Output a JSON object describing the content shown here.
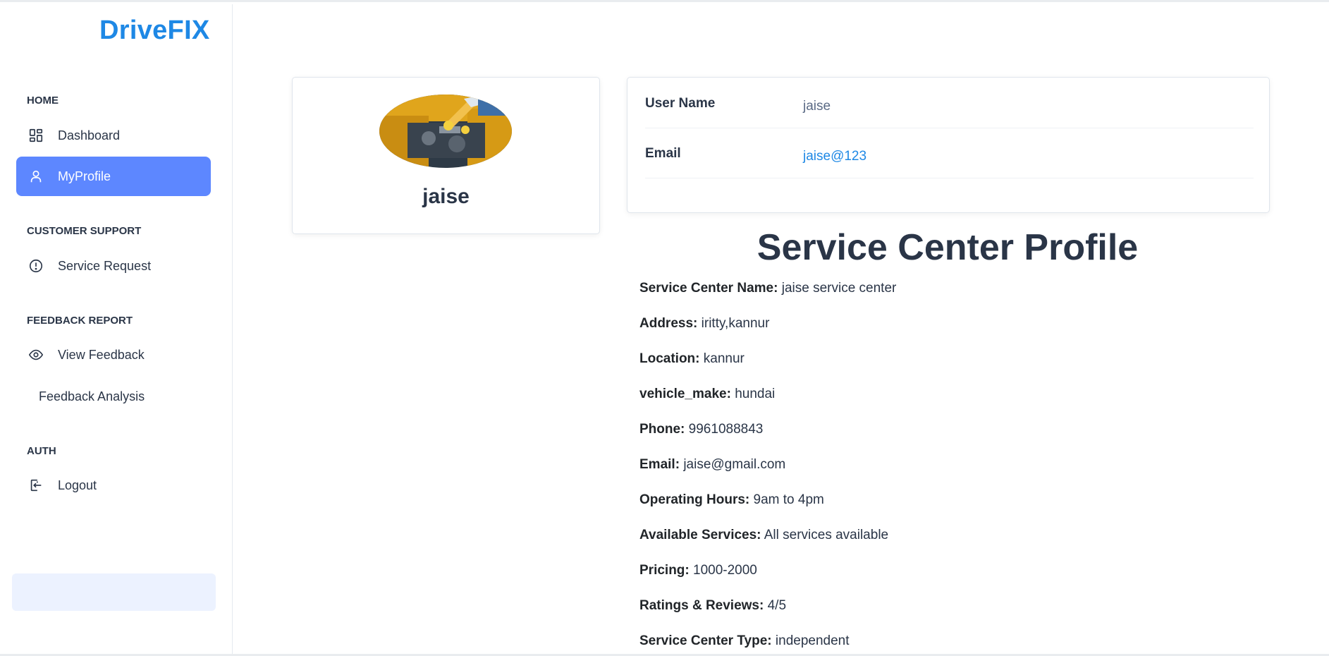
{
  "brand": "DriveFIX",
  "sidebar": {
    "sections": [
      {
        "caption": "HOME"
      },
      {
        "caption": "CUSTOMER SUPPORT"
      },
      {
        "caption": "FEEDBACK REPORT"
      },
      {
        "caption": "AUTH"
      }
    ],
    "items": [
      {
        "label": "Dashboard",
        "icon": "dashboard-icon"
      },
      {
        "label": "MyProfile",
        "icon": "user-icon",
        "active": true
      },
      {
        "label": "Service Request",
        "icon": "alert-circle-icon"
      },
      {
        "label": "View Feedback",
        "icon": "eye-icon"
      },
      {
        "label": "Feedback Analysis"
      },
      {
        "label": "Logout",
        "icon": "logout-icon"
      }
    ]
  },
  "profile": {
    "name": "jaise",
    "avatar_icon": "mechanic-photo"
  },
  "account": {
    "rows": [
      {
        "label": "User Name",
        "value": "jaise"
      },
      {
        "label": "Email",
        "value": "jaise@123"
      }
    ]
  },
  "service_center": {
    "title": "Service Center Profile",
    "fields": [
      {
        "label": "Service Center Name:",
        "value": "jaise service center"
      },
      {
        "label": "Address:",
        "value": "iritty,kannur"
      },
      {
        "label": "Location:",
        "value": "kannur"
      },
      {
        "label": "vehicle_make:",
        "value": "hundai"
      },
      {
        "label": "Phone:",
        "value": "9961088843"
      },
      {
        "label": "Email:",
        "value": "jaise@gmail.com"
      },
      {
        "label": "Operating Hours:",
        "value": "9am to 4pm"
      },
      {
        "label": "Available Services:",
        "value": "All services available"
      },
      {
        "label": "Pricing:",
        "value": "1000-2000"
      },
      {
        "label": "Ratings & Reviews:",
        "value": "4/5"
      },
      {
        "label": "Service Center Type:",
        "value": "independent"
      }
    ]
  },
  "colors": {
    "brand": "#1e88e5",
    "active_nav": "#5d87ff",
    "text": "#2a3547"
  }
}
